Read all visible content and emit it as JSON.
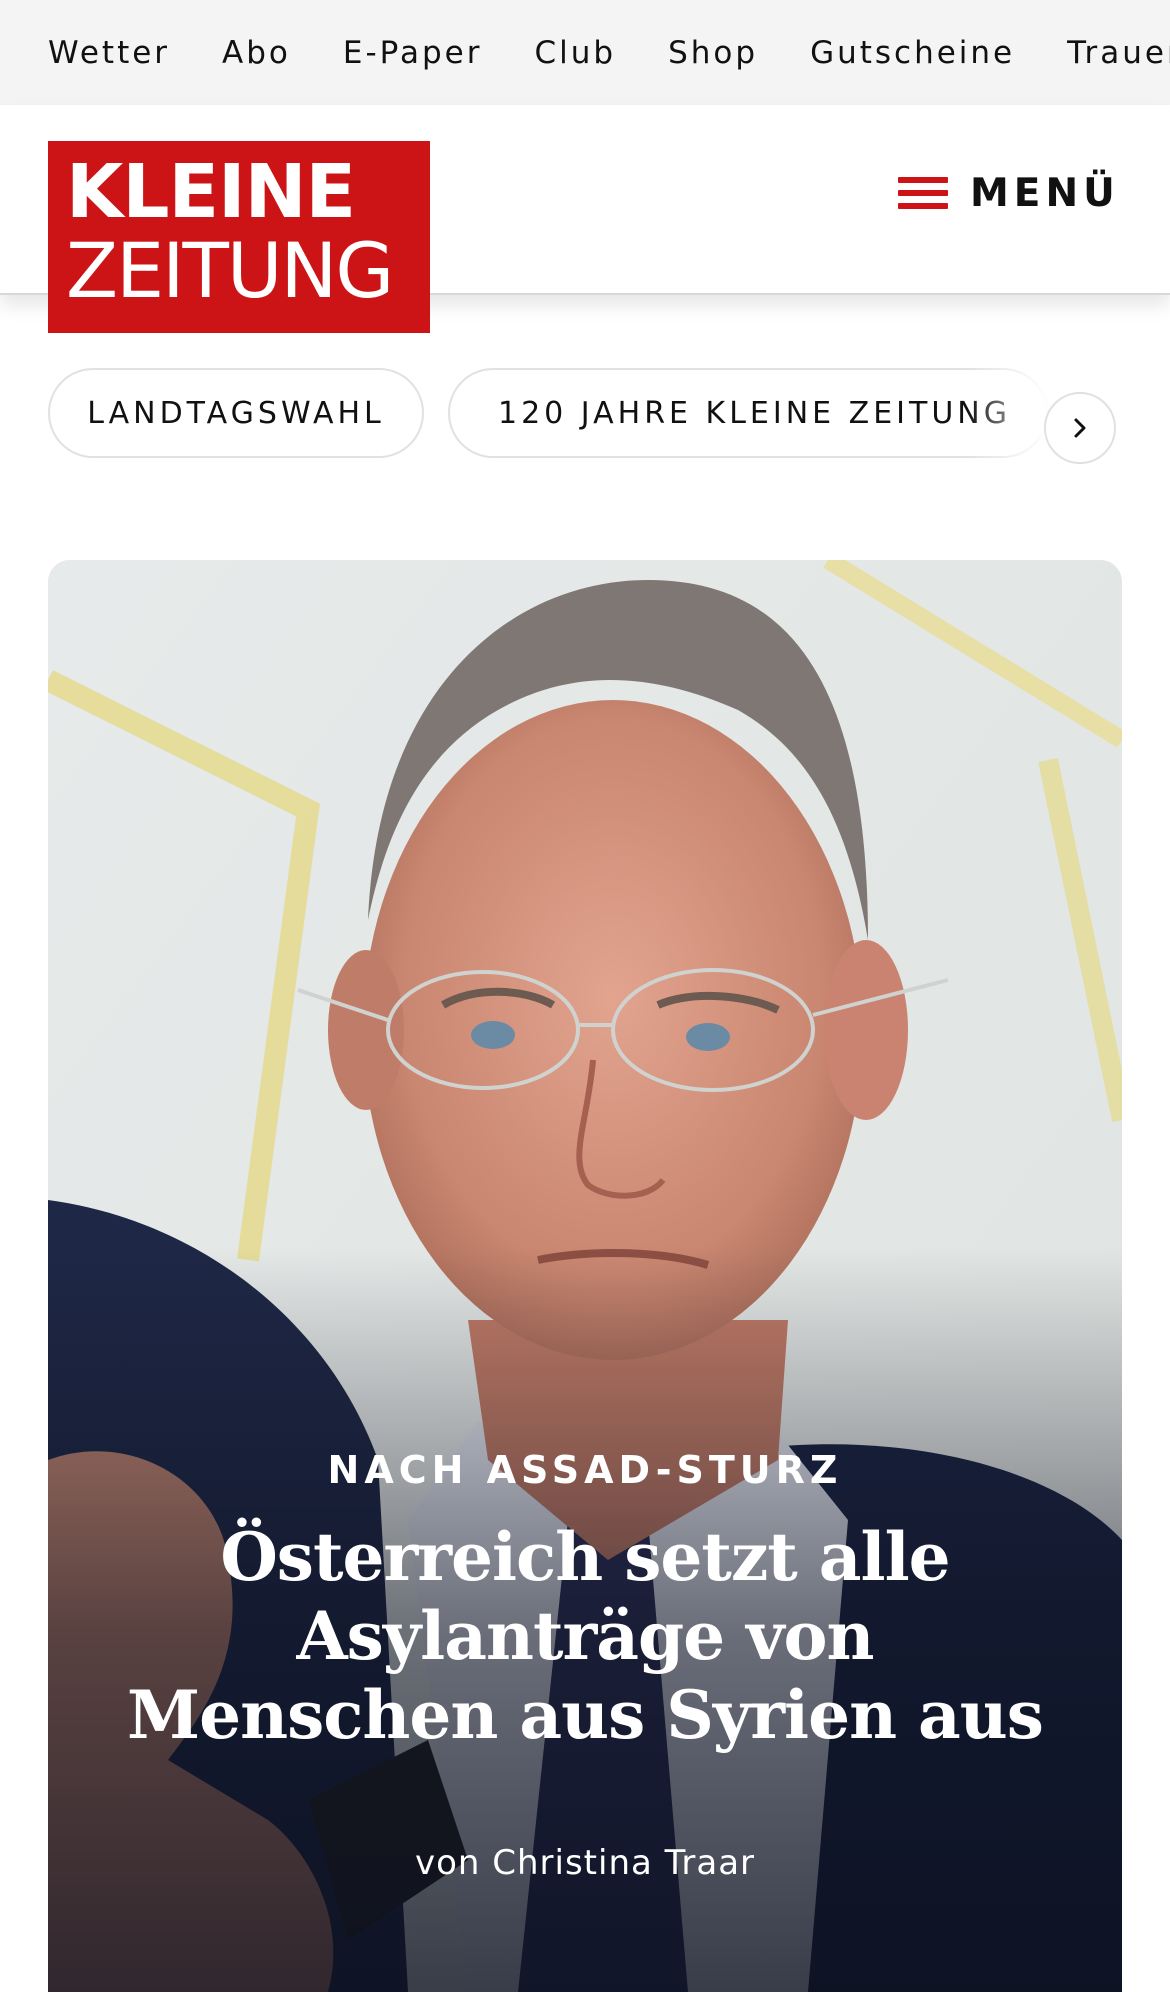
{
  "topbar": {
    "links": [
      "Wetter",
      "Abo",
      "E-Paper",
      "Club",
      "Shop",
      "Gutscheine",
      "Trauerp"
    ]
  },
  "header": {
    "logo_line1": "KLEINE",
    "logo_line2": "ZEITUNG",
    "menu_label": "MENÜ"
  },
  "chips": {
    "items": [
      "LANDTAGSWAHL",
      "120 JAHRE KLEINE ZEITUNG"
    ],
    "next_icon": "chevron-right-icon"
  },
  "hero": {
    "kicker": "NACH ASSAD-STURZ",
    "headline_lines": [
      "Österreich setzt alle",
      "Asylanträge von",
      "Menschen aus Syrien aus"
    ],
    "byline": "von Christina Traar"
  },
  "colors": {
    "brand_red": "#cc1416",
    "topbar_bg": "#f4f4f4"
  }
}
